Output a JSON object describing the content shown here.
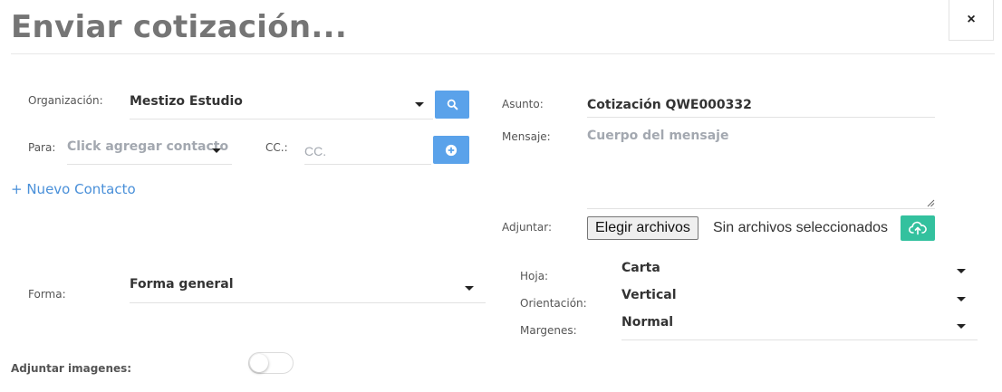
{
  "modal": {
    "title": "Enviar cotización...",
    "close_label": "×"
  },
  "form": {
    "organizacion": {
      "label": "Organización:",
      "value": "Mestizo Estudio"
    },
    "para": {
      "label": "Para:",
      "placeholder": "Click agregar contacto"
    },
    "cc": {
      "label": "CC.:",
      "placeholder": "CC."
    },
    "nuevo_contacto": "+ Nuevo Contacto",
    "asunto": {
      "label": "Asunto:",
      "value": "Cotización QWE000332"
    },
    "mensaje": {
      "label": "Mensaje:",
      "placeholder": "Cuerpo del mensaje"
    },
    "adjuntar": {
      "label": "Adjuntar:",
      "button_label": "Elegir archivos",
      "status": "Sin archivos seleccionados"
    },
    "forma": {
      "label": "Forma:",
      "value": "Forma general"
    },
    "hoja": {
      "label": "Hoja:",
      "value": "Carta"
    },
    "orientacion": {
      "label": "Orientación:",
      "value": "Vertical"
    },
    "margenes": {
      "label": "Margenes:",
      "value": "Normal"
    },
    "adjuntar_imagenes": {
      "label": "Adjuntar imagenes:",
      "enabled": false
    }
  },
  "colors": {
    "primary": "#5aa2ea",
    "success": "#33c19e",
    "link": "#4a90d9",
    "title": "#757575"
  },
  "icons": {
    "search": "search-icon",
    "add": "plus-circle-icon",
    "upload": "cloud-upload-icon",
    "close": "close-icon"
  }
}
